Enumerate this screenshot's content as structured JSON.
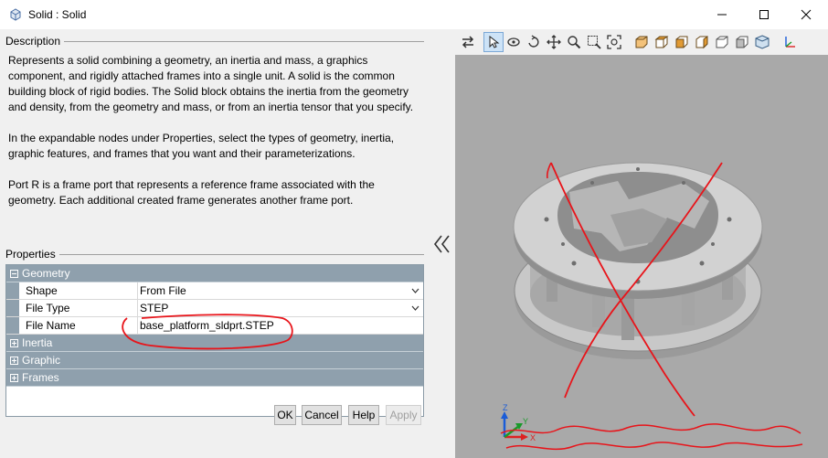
{
  "window": {
    "title": "Solid : Solid"
  },
  "description": {
    "heading": "Description",
    "paragraphs": [
      "Represents a solid combining a geometry, an inertia and mass, a graphics component, and rigidly attached frames into a single unit. A solid is the common building block of rigid bodies. The Solid block obtains the inertia from the geometry and density, from the geometry and mass, or from an inertia tensor that you specify.",
      "In the expandable nodes under Properties, select the types of geometry, inertia, graphic features, and frames that you want and their parameterizations.",
      "Port R is a frame port that represents a reference frame associated with the geometry. Each additional created frame generates another frame port."
    ]
  },
  "properties": {
    "heading": "Properties",
    "groups": {
      "geometry": "Geometry",
      "inertia": "Inertia",
      "graphic": "Graphic",
      "frames": "Frames"
    },
    "rows": {
      "shape_label": "Shape",
      "shape_value": "From File",
      "filetype_label": "File Type",
      "filetype_value": "STEP",
      "filename_label": "File Name",
      "filename_value": "base_platform_sldprt.STEP"
    }
  },
  "buttons": {
    "ok": "OK",
    "cancel": "Cancel",
    "help": "Help",
    "apply": "Apply"
  },
  "viewer": {
    "axes": {
      "z": "Z",
      "y": "Y",
      "x": "X"
    },
    "toolbar_icons": [
      "swap-icon",
      "select-icon",
      "rotate-icon",
      "orbit-icon",
      "pan-icon",
      "zoom-icon",
      "zoom-box-icon",
      "fit-icon",
      "view-front-icon",
      "view-back-icon",
      "view-left-icon",
      "view-right-icon",
      "view-top-icon",
      "view-iso-icon",
      "axes-icon"
    ]
  },
  "colors": {
    "accent": "#8fa0ad",
    "annotation": "#e8141a",
    "canvas": "#a9a9a9"
  }
}
